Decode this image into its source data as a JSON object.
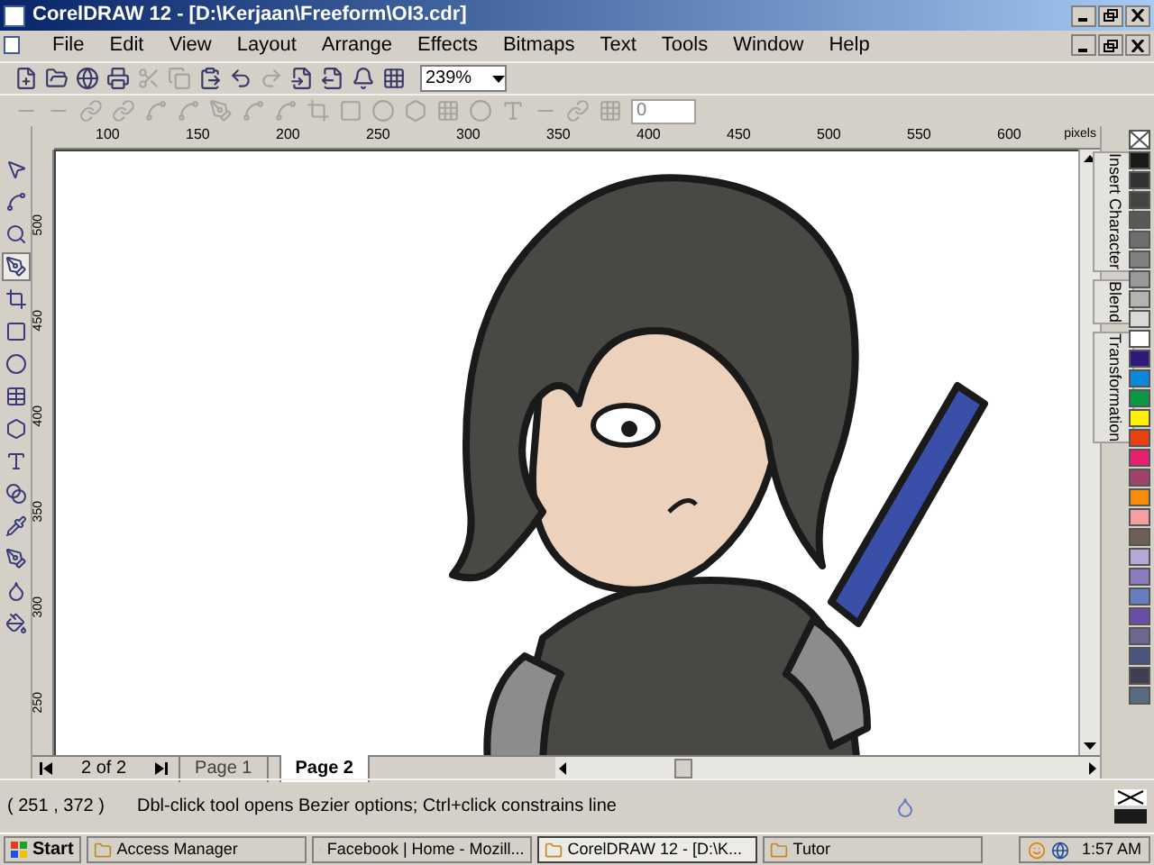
{
  "window": {
    "title": "CorelDRAW 12 - [D:\\Kerjaan\\Freeform\\OI3.cdr]"
  },
  "menu": [
    "File",
    "Edit",
    "View",
    "Layout",
    "Arrange",
    "Effects",
    "Bitmaps",
    "Text",
    "Tools",
    "Window",
    "Help"
  ],
  "zoom": {
    "value": "239%"
  },
  "property_bar": {
    "field_value": "0"
  },
  "ruler_h": {
    "labels": [
      "100",
      "150",
      "200",
      "250",
      "300",
      "350",
      "400",
      "450",
      "500",
      "550",
      "600"
    ],
    "unit": "pixels"
  },
  "ruler_v": {
    "labels": [
      "500",
      "450",
      "400",
      "350",
      "300",
      "250"
    ]
  },
  "toolbox": [
    {
      "selected": false
    },
    {
      "selected": false
    },
    {
      "selected": false
    },
    {
      "selected": true
    },
    {
      "selected": false
    },
    {
      "selected": false
    },
    {
      "selected": false
    },
    {
      "selected": false
    },
    {
      "selected": false
    },
    {
      "selected": false
    },
    {
      "selected": false
    },
    {
      "selected": false
    },
    {
      "selected": false
    },
    {
      "selected": false
    },
    {
      "selected": false
    }
  ],
  "dockers": [
    {
      "label": "Insert Character"
    },
    {
      "label": "Blend"
    },
    {
      "label": "Transformation"
    }
  ],
  "palette": [
    {
      "color": "#1a1a1a"
    },
    {
      "color": "#333333"
    },
    {
      "color": "#444444"
    },
    {
      "color": "#595959"
    },
    {
      "color": "#6e6e6e"
    },
    {
      "color": "#808080"
    },
    {
      "color": "#999999"
    },
    {
      "color": "#b3b3b3"
    },
    {
      "color": "#d9d9d9"
    },
    {
      "color": "#ffffff"
    },
    {
      "color": "#2e1a7a"
    },
    {
      "color": "#0a8ad8"
    },
    {
      "color": "#0a9a46"
    },
    {
      "color": "#fff200"
    },
    {
      "color": "#e8420f"
    },
    {
      "color": "#e6206e"
    },
    {
      "color": "#a0426e"
    },
    {
      "color": "#f78c0a"
    },
    {
      "color": "#f4a0a0"
    },
    {
      "color": "#6e5e54"
    },
    {
      "color": "#b4a8d6"
    },
    {
      "color": "#8a7cbe"
    },
    {
      "color": "#6a7cc4"
    },
    {
      "color": "#6a4ea8"
    },
    {
      "color": "#6e6890"
    },
    {
      "color": "#4a5480"
    },
    {
      "color": "#403e52"
    },
    {
      "color": "#5a6a80"
    }
  ],
  "page_nav": {
    "counter": "2 of 2",
    "tabs": [
      {
        "label": "Page 1",
        "selected": false
      },
      {
        "label": "Page 2",
        "selected": true
      }
    ]
  },
  "status_bar": {
    "coordinates": "( 251 , 372 )",
    "hint": "Dbl-click tool opens Bezier options; Ctrl+click constrains line"
  },
  "taskbar": {
    "start": "Start",
    "tasks": [
      {
        "label": "Access Manager",
        "selected": false
      },
      {
        "label": "Facebook | Home - Mozill...",
        "selected": false
      },
      {
        "label": "CorelDRAW 12 - [D:\\K...",
        "selected": true
      },
      {
        "label": "Tutor",
        "selected": false
      }
    ],
    "time": "1:57 AM"
  }
}
